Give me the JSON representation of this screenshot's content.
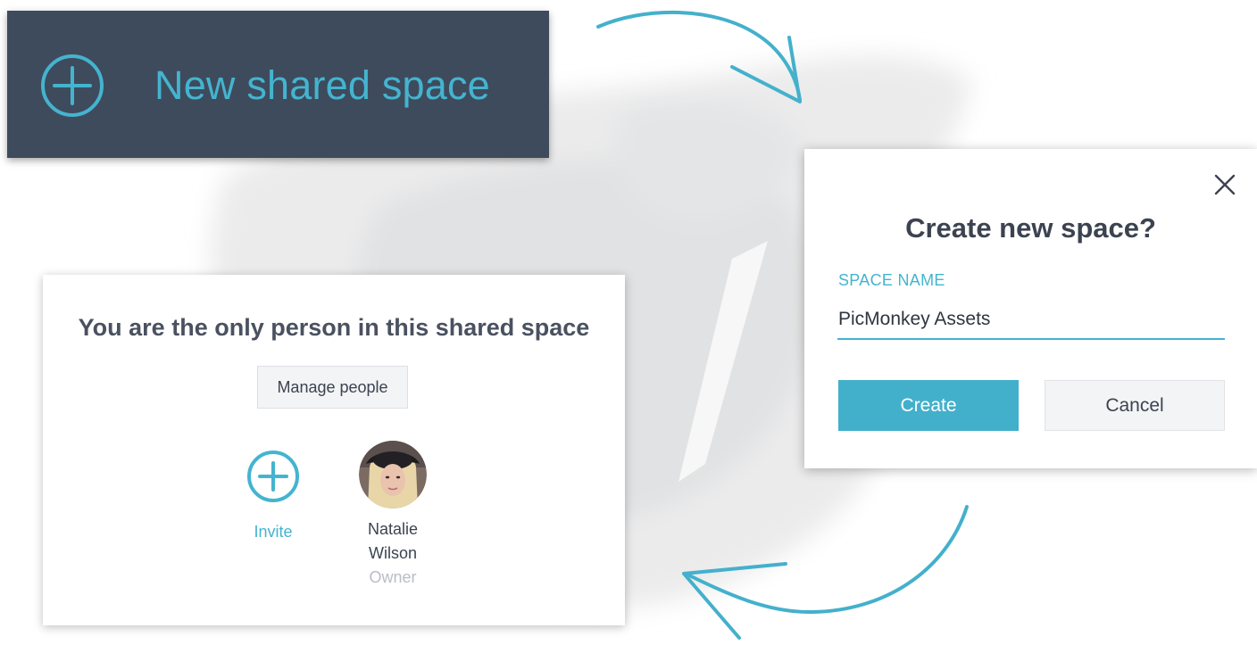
{
  "banner": {
    "label": "New shared space",
    "icon": "plus-circle-icon"
  },
  "dialog": {
    "title": "Create new space?",
    "field_label": "SPACE NAME",
    "name_value": "PicMonkey Assets",
    "create_label": "Create",
    "cancel_label": "Cancel",
    "close_icon": "close-icon"
  },
  "card": {
    "heading": "You are the only person in this shared space",
    "manage_label": "Manage people",
    "invite_label": "Invite",
    "member": {
      "name": "Natalie Wilson",
      "role": "Owner"
    }
  },
  "colors": {
    "accent": "#44b4cf",
    "banner_bg": "#3e4b5d",
    "text_dark": "#3c4350",
    "muted": "#b9bdc4"
  }
}
